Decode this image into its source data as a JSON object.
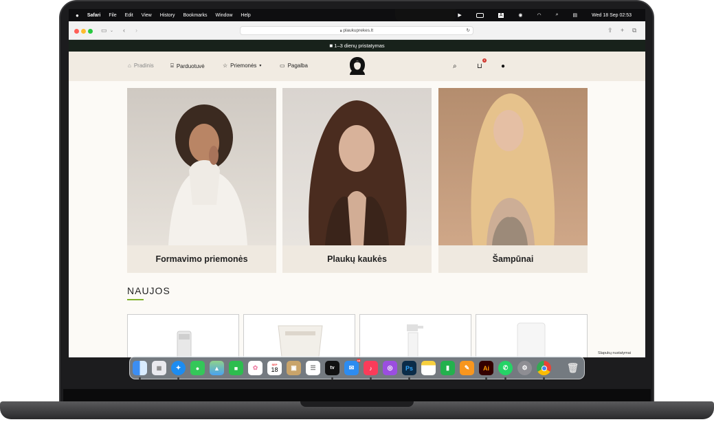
{
  "menubar": {
    "apple": "",
    "app": "Safari",
    "items": [
      "File",
      "Edit",
      "View",
      "History",
      "Bookmarks",
      "Window",
      "Help"
    ],
    "datetime": "Wed 18 Sep  02:53"
  },
  "browser": {
    "url": "plaukuprekes.lt"
  },
  "announcement": "1–3 dienų pristatymas",
  "nav": {
    "home": "Pradinis",
    "shop": "Parduotuvė",
    "tools": "Priemonės",
    "help": "Pagalba",
    "cart_count": "0"
  },
  "categories": [
    {
      "label": "Formavimo priemonės"
    },
    {
      "label": "Plaukų kaukės"
    },
    {
      "label": "Šampūnai"
    }
  ],
  "section_title": "NAUJOS",
  "cookie_text": "Slapukų nustatymai",
  "dock": {
    "calendar_month": "SEP",
    "calendar_day": "18",
    "mail_badge": "44",
    "icons": [
      "finder-icon",
      "launchpad-icon",
      "safari-icon",
      "messages-icon",
      "maps-icon",
      "facetime-icon",
      "photos-icon",
      "calendar-icon",
      "notes-app-icon",
      "reminders-icon",
      "appletv-icon",
      "mail-icon",
      "music-icon",
      "podcasts-icon",
      "photoshop-icon",
      "notes-icon",
      "numbers-icon",
      "pages-icon",
      "illustrator-icon",
      "whatsapp-icon",
      "settings-icon",
      "chrome-icon",
      "trash-icon"
    ],
    "labels": {
      "appletv": "tv",
      "photoshop": "Ps",
      "illustrator": "Ai"
    }
  },
  "colors": {
    "accent": "#7fb02a",
    "announce_bg": "#18221b",
    "nav_bg": "#f1ebe2",
    "card_bg": "#efe9e0"
  }
}
